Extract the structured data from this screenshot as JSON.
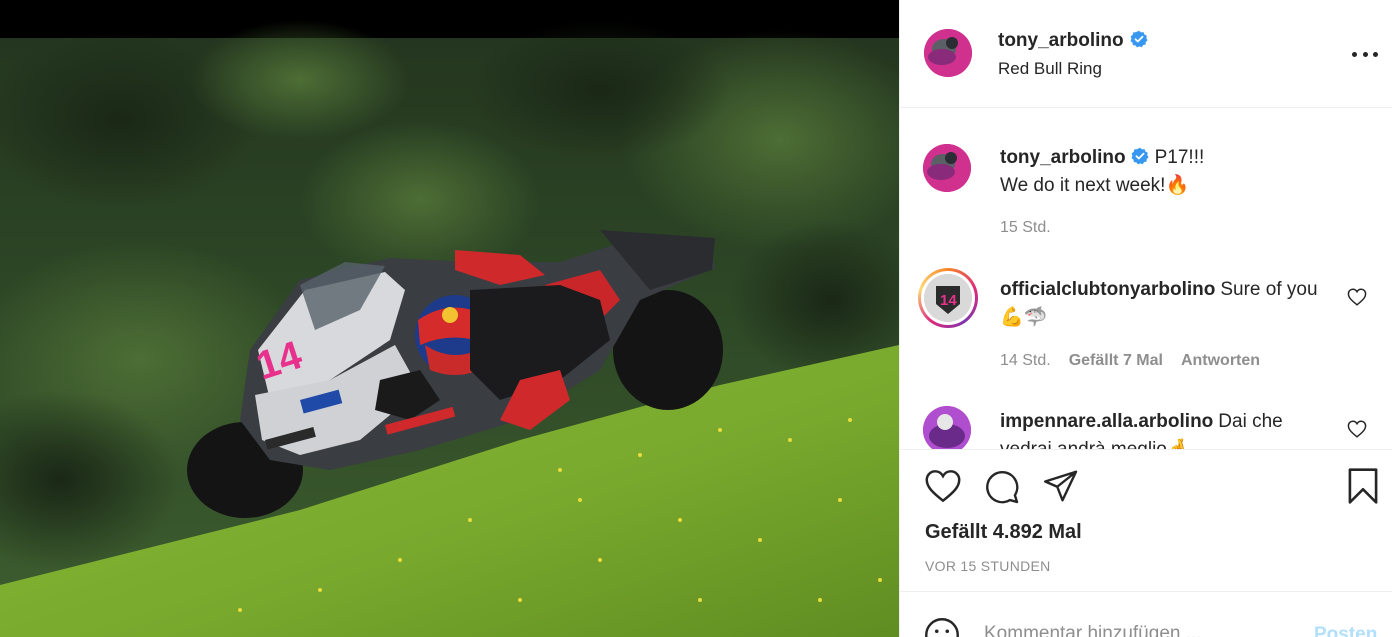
{
  "post": {
    "username": "tony_arbolino",
    "location": "Red Bull Ring",
    "more_icon": "more-horizontal-icon",
    "photo_alt": "motorcycle-racer-photo"
  },
  "caption": {
    "username": "tony_arbolino",
    "line1": "P17!!!",
    "line2": "We do it next week!🔥",
    "time": "15 Std."
  },
  "comments": [
    {
      "username": "officialclubtonyarbolino",
      "text": "Sure of you💪🦈",
      "time": "14 Std.",
      "likes": "Gefällt 7 Mal",
      "reply": "Antworten"
    },
    {
      "username": "impennare.alla.arbolino",
      "text": "Dai che vedrai andrà meglio🤞"
    }
  ],
  "actions": {
    "likes": "Gefällt 4.892 Mal",
    "timestamp": "VOR 15 STUNDEN"
  },
  "comment_bar": {
    "placeholder": "Kommentar hinzufügen ...",
    "post_label": "Posten"
  },
  "colors": {
    "verified": "#3897f0",
    "meta_gray": "#8e8e8e",
    "post_disabled": "#b2dffc",
    "number_pink": "#e8318c"
  }
}
